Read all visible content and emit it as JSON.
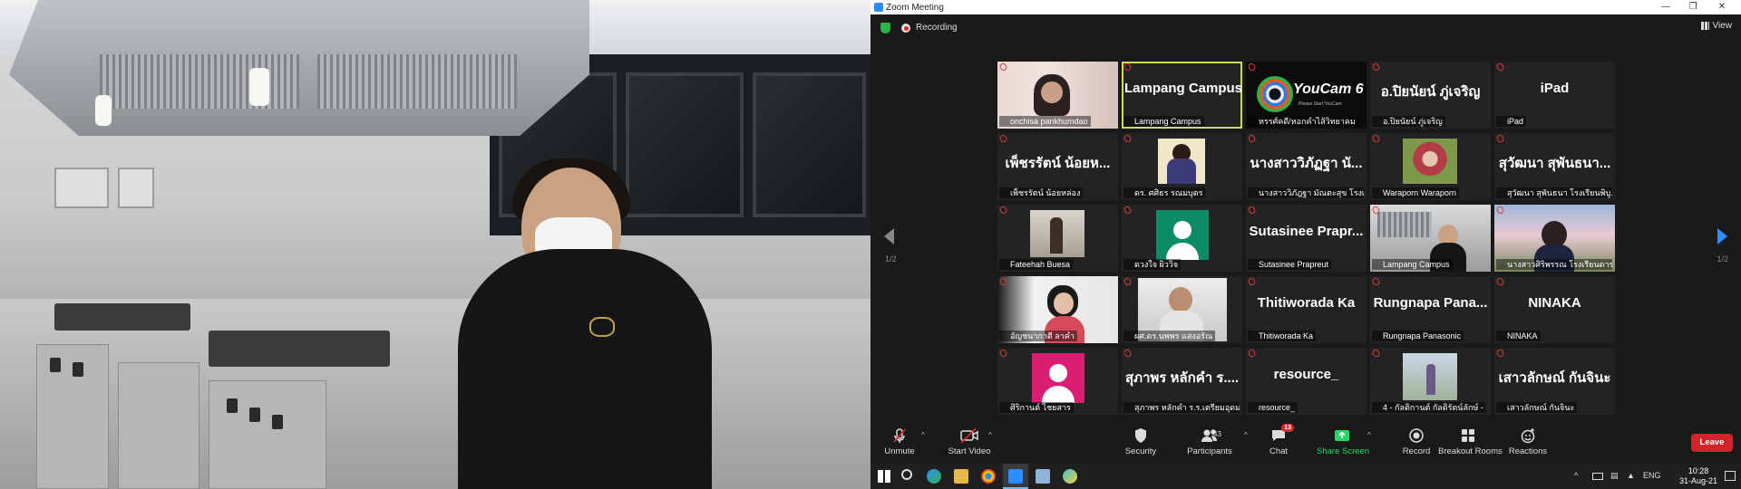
{
  "window": {
    "title": "Zoom Meeting"
  },
  "topbar": {
    "recording_label": "Recording",
    "view_label": "View"
  },
  "gallery": {
    "page_left": "1/2",
    "page_right": "1/2",
    "tiles": [
      {
        "label": "onchisa pankhumdao",
        "display": ""
      },
      {
        "label": "Lampang Campus",
        "display": "Lampang Campus"
      },
      {
        "label": "หรรศ์คดี/หอกคำไส้วิทยาคม",
        "display": "YouCam 6",
        "sub": "Please Start YouCam"
      },
      {
        "label": "อ.ปิยนัยน์ ภู่เจริญ",
        "display": "อ.ปิยนัยน์ ภู่เจริญ"
      },
      {
        "label": "iPad",
        "display": "iPad"
      },
      {
        "label": "เพ็ชรรัตน์ น้อยหล่อง",
        "display": "เพ็ชรรัตน์ น้อยห..."
      },
      {
        "label": "ดร. ศศิธร รณมบุตร",
        "display": ""
      },
      {
        "label": "นางสาววิภัฎฐา มัณตะสุข โรงเรี...",
        "display": "นางสาววิภัฏฐา นั..."
      },
      {
        "label": "Waraporn Waraporn",
        "display": ""
      },
      {
        "label": "สุวัฒนา สุพันธนา โรงเรียนพิบู...",
        "display": "สุวัฒนา สุพันธนา..."
      },
      {
        "label": "Fateehah  Buesa",
        "display": ""
      },
      {
        "label": "ดวงใจ ผิววิจ",
        "display": ""
      },
      {
        "label": "Sutasinee Prapreut",
        "display": "Sutasinee  Prapr..."
      },
      {
        "label": "Lampang Campus",
        "display": ""
      },
      {
        "label": "นางสาวศิริพรรณ โรงเรียนดาร...",
        "display": ""
      },
      {
        "label": "อัญชนากาตี ลาคำ",
        "display": ""
      },
      {
        "label": "ผศ.ดร.นพพร แสงอรัณ",
        "display": ""
      },
      {
        "label": "Thitiworada Ka",
        "display": "Thitiworada Ka"
      },
      {
        "label": "Rungnapa Panasonic",
        "display": "Rungnapa  Pana..."
      },
      {
        "label": "NINAKA",
        "display": "NINAKA"
      },
      {
        "label": "ศิริกานต์ ไชยสาร",
        "display": ""
      },
      {
        "label": "สุภาพร หลักคำ ร.ร.เตรียมอุดม...",
        "display": "สุภาพร หลักคำ ร...."
      },
      {
        "label": "resource_",
        "display": "resource_"
      },
      {
        "label": "4 - กัลติกานต์ กัลติรัตน์ลักษ์ -",
        "display": ""
      },
      {
        "label": "เสาวลักษณ์ กันจินะ",
        "display": "เสาวลักษณ์ กันจินะ"
      }
    ]
  },
  "toolbar": {
    "unmute": "Unmute",
    "start_video": "Start Video",
    "security": "Security",
    "participants": "Participants",
    "participants_count": "43",
    "chat": "Chat",
    "chat_badge": "13",
    "share_screen": "Share Screen",
    "record": "Record",
    "breakout_rooms": "Breakout Rooms",
    "reactions": "Reactions",
    "leave": "Leave"
  },
  "taskbar": {
    "language": "ENG",
    "time": "10:28",
    "date": "31-Aug-21"
  },
  "colors": {
    "active_speaker": "#c4e25a",
    "share_green": "#23d962",
    "leave_red": "#d3242a",
    "zoom_blue": "#2d8cff"
  }
}
